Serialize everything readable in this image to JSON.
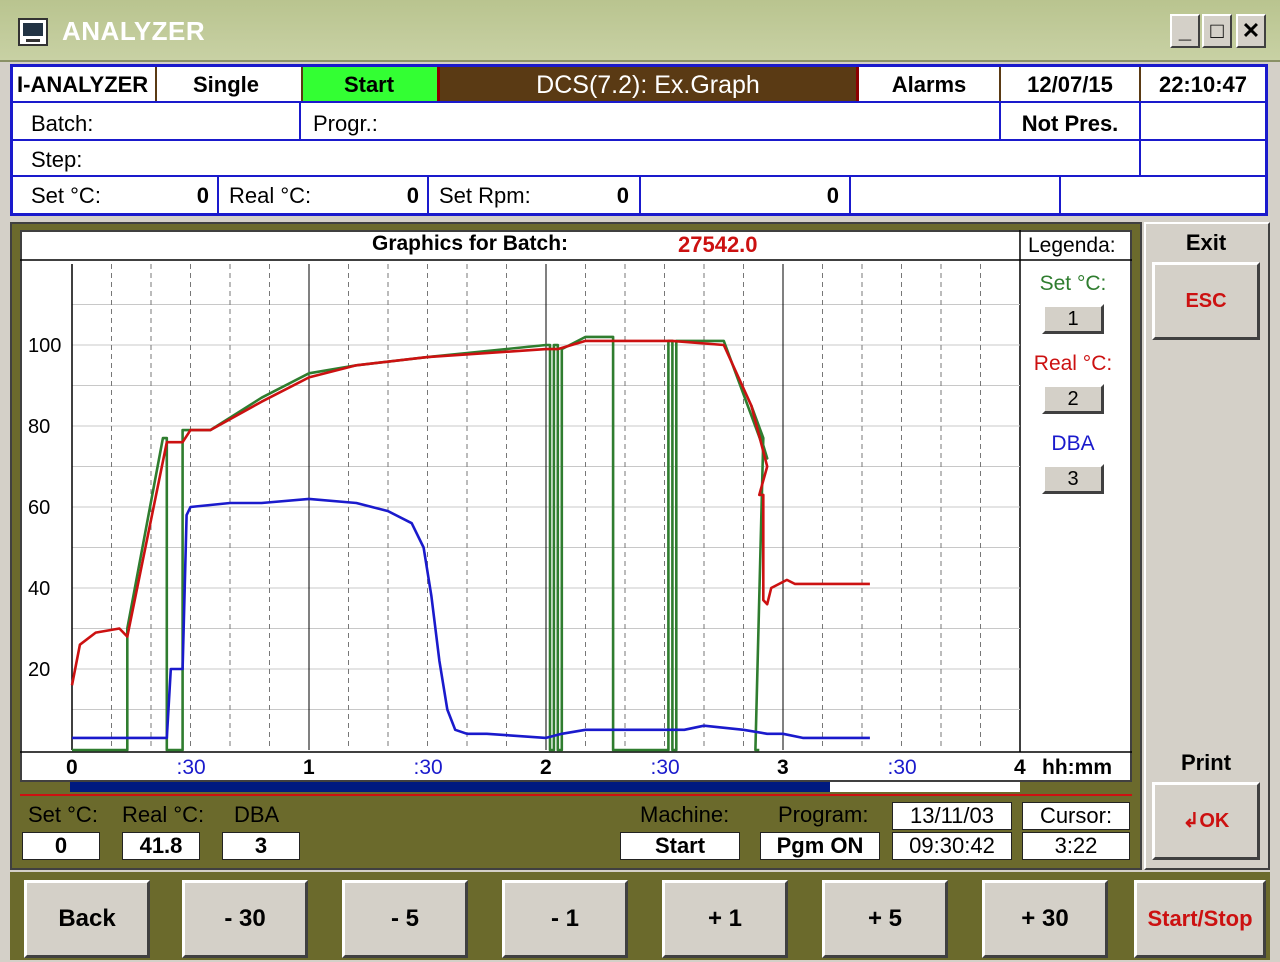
{
  "window": {
    "title": "ANALYZER",
    "minimize": "_",
    "maximize": "□",
    "close": "✕"
  },
  "header": {
    "row1": {
      "device": "I-ANALYZER",
      "mode": "Single",
      "status": "Start",
      "screen": "DCS(7.2): Ex.Graph",
      "alarms": "Alarms",
      "date": "12/07/15",
      "time": "22:10:47"
    },
    "row2": {
      "batch_label": "Batch:",
      "program_label": "Progr.:",
      "program_status": "Not Pres."
    },
    "row3": {
      "step_label": "Step:"
    },
    "row4": {
      "set_c_label": "Set °C:",
      "set_c_value": "0",
      "real_c_label": "Real °C:",
      "real_c_value": "0",
      "set_rpm_label": "Set Rpm:",
      "set_rpm_value": "0",
      "extra_value": "0"
    }
  },
  "graph": {
    "title_label": "Graphics for Batch:",
    "batch_number": "27542.0",
    "legend_title": "Legenda:",
    "legend": [
      {
        "name": "Set °C:",
        "button": "1",
        "color": "#2f7d2f"
      },
      {
        "name": "Real °C:",
        "button": "2",
        "color": "#cc1111"
      },
      {
        "name": "DBA",
        "button": "3",
        "color": "#1a1acc"
      }
    ]
  },
  "chart_data": {
    "type": "line",
    "title": "Graphics for Batch: 27542.0",
    "xlabel": "hh:mm",
    "ylabel": "",
    "x_unit": "minutes",
    "xlim": [
      0,
      240
    ],
    "ylim": [
      0,
      120
    ],
    "x_ticks": [
      {
        "value": 0,
        "label": "0",
        "major": true
      },
      {
        "value": 30,
        "label": ":30",
        "major": false
      },
      {
        "value": 60,
        "label": "1",
        "major": true
      },
      {
        "value": 90,
        "label": ":30",
        "major": false
      },
      {
        "value": 120,
        "label": "2",
        "major": true
      },
      {
        "value": 150,
        "label": ":30",
        "major": false
      },
      {
        "value": 180,
        "label": "3",
        "major": true
      },
      {
        "value": 210,
        "label": ":30",
        "major": false
      },
      {
        "value": 240,
        "label": "4",
        "major": true
      }
    ],
    "y_ticks": [
      20,
      40,
      60,
      80,
      100
    ],
    "grid": true,
    "legend_position": "right",
    "series": [
      {
        "name": "Set °C:",
        "color": "#2f7d2f",
        "points": [
          [
            0,
            0
          ],
          [
            14,
            0
          ],
          [
            14,
            30
          ],
          [
            23,
            77
          ],
          [
            24,
            77
          ],
          [
            24,
            0
          ],
          [
            28,
            0
          ],
          [
            28,
            79
          ],
          [
            35,
            79
          ],
          [
            48,
            87
          ],
          [
            60,
            93
          ],
          [
            72,
            95
          ],
          [
            90,
            97
          ],
          [
            120,
            100
          ],
          [
            121,
            100
          ],
          [
            121,
            0
          ],
          [
            122,
            0
          ],
          [
            122,
            100
          ],
          [
            123,
            100
          ],
          [
            123,
            0
          ],
          [
            124,
            0
          ],
          [
            124,
            99
          ],
          [
            130,
            102
          ],
          [
            137,
            102
          ],
          [
            137,
            0
          ],
          [
            151,
            0
          ],
          [
            151,
            101
          ],
          [
            152,
            101
          ],
          [
            152,
            0
          ],
          [
            153,
            0
          ],
          [
            153,
            101
          ],
          [
            165,
            101
          ],
          [
            176,
            72
          ],
          [
            172,
            85
          ],
          [
            175,
            77
          ],
          [
            173,
            0
          ],
          [
            174,
            0
          ]
        ]
      },
      {
        "name": "Real °C:",
        "color": "#cc1111",
        "points": [
          [
            0,
            16
          ],
          [
            2,
            26
          ],
          [
            6,
            29
          ],
          [
            12,
            30
          ],
          [
            14,
            28
          ],
          [
            24,
            76
          ],
          [
            28,
            76
          ],
          [
            30,
            79
          ],
          [
            35,
            79
          ],
          [
            48,
            86
          ],
          [
            60,
            92
          ],
          [
            72,
            95
          ],
          [
            90,
            97
          ],
          [
            120,
            99
          ],
          [
            123,
            99
          ],
          [
            130,
            101
          ],
          [
            152,
            101
          ],
          [
            165,
            100
          ],
          [
            172,
            85
          ],
          [
            176,
            70
          ],
          [
            174,
            63
          ],
          [
            175,
            63
          ],
          [
            175,
            37
          ],
          [
            176,
            36
          ],
          [
            177,
            40
          ],
          [
            181,
            42
          ],
          [
            183,
            41
          ],
          [
            202,
            41
          ]
        ]
      },
      {
        "name": "DBA",
        "color": "#1a1acc",
        "points": [
          [
            0,
            3
          ],
          [
            24,
            3
          ],
          [
            25,
            20
          ],
          [
            28,
            20
          ],
          [
            29,
            58
          ],
          [
            30,
            60
          ],
          [
            40,
            61
          ],
          [
            48,
            61
          ],
          [
            60,
            62
          ],
          [
            72,
            61
          ],
          [
            80,
            59
          ],
          [
            86,
            56
          ],
          [
            89,
            50
          ],
          [
            91,
            38
          ],
          [
            93,
            22
          ],
          [
            95,
            10
          ],
          [
            97,
            5
          ],
          [
            100,
            4
          ],
          [
            105,
            4
          ],
          [
            120,
            3
          ],
          [
            124,
            4
          ],
          [
            130,
            5
          ],
          [
            152,
            5
          ],
          [
            155,
            5
          ],
          [
            160,
            6
          ],
          [
            170,
            5
          ],
          [
            176,
            4
          ],
          [
            180,
            4
          ],
          [
            185,
            3
          ],
          [
            202,
            3
          ]
        ]
      }
    ]
  },
  "readouts": {
    "set_c": {
      "label": "Set °C:",
      "value": "0"
    },
    "real_c": {
      "label": "Real °C:",
      "value": "41.8"
    },
    "dba": {
      "label": "DBA",
      "value": "3"
    },
    "machine": {
      "label": "Machine:",
      "value": "Start"
    },
    "program": {
      "label": "Program:",
      "value": "Pgm ON"
    },
    "datetime": {
      "date": "13/11/03",
      "time": "09:30:42"
    },
    "cursor": {
      "label": "Cursor:",
      "value": "3:22"
    },
    "progress": 0.8
  },
  "side": {
    "exit_label": "Exit",
    "esc_button": "ESC",
    "print_label": "Print",
    "ok_button": "OK"
  },
  "footer": {
    "back": "Back",
    "minus30": "- 30",
    "minus5": "- 5",
    "minus1": "- 1",
    "plus1": "+ 1",
    "plus5": "+ 5",
    "plus30": "+ 30",
    "startstop": "Start/Stop"
  },
  "colors": {
    "accent_green": "#33ff33",
    "panel_olive": "#6b6a2c",
    "header_brown": "#5a3a14",
    "border_blue": "#1a1acc",
    "danger_red": "#cc1111"
  }
}
